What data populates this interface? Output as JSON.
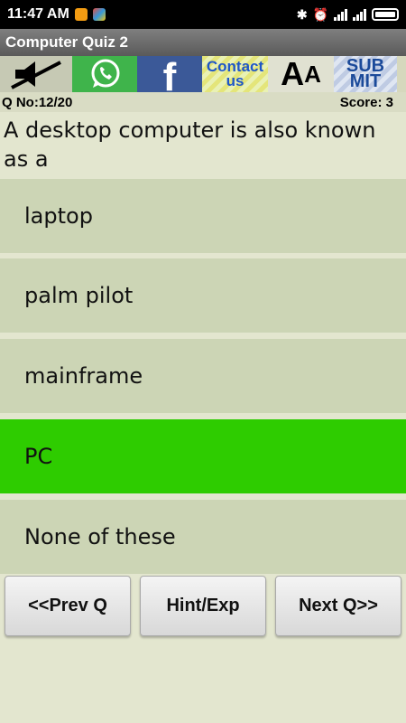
{
  "status_bar": {
    "time": "11:47 AM"
  },
  "app": {
    "title": "Computer Quiz 2"
  },
  "icons": {
    "contact_line1": "Contact",
    "contact_line2": "us",
    "font_big": "A",
    "font_small": "A",
    "submit_line1": "SUB",
    "submit_line2": "MIT",
    "facebook_glyph": "f"
  },
  "quiz": {
    "question_number": "Q No:12/20",
    "score": "Score: 3",
    "question": "A desktop computer is also known as a",
    "options": [
      "laptop",
      "palm pilot",
      "mainframe",
      "PC",
      "None of these"
    ],
    "selected_option_index": 3,
    "selected_color": "#2ecc00",
    "option_color": "#ccd5b5"
  },
  "nav": {
    "prev_label": "<<Prev Q",
    "hint_label": "Hint/Exp",
    "next_label": "Next Q>>"
  }
}
